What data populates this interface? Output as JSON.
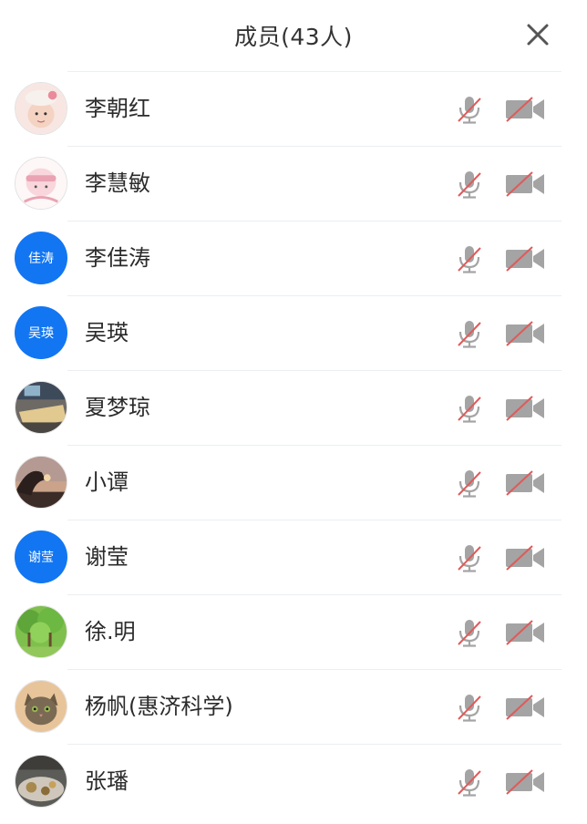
{
  "header": {
    "title": "成员(43人)"
  },
  "members": [
    {
      "name": "李朝红",
      "avatar_type": "photo",
      "avatar_scene": "baby"
    },
    {
      "name": "李慧敏",
      "avatar_type": "photo",
      "avatar_scene": "cartoon"
    },
    {
      "name": "李佳涛",
      "avatar_type": "text",
      "avatar_text": "佳涛"
    },
    {
      "name": "吴瑛",
      "avatar_type": "text",
      "avatar_text": "吴瑛"
    },
    {
      "name": "夏梦琼",
      "avatar_type": "photo",
      "avatar_scene": "room"
    },
    {
      "name": "小谭",
      "avatar_type": "photo",
      "avatar_scene": "sunset-hand"
    },
    {
      "name": "谢莹",
      "avatar_type": "text",
      "avatar_text": "谢莹"
    },
    {
      "name": "徐.明",
      "avatar_type": "photo",
      "avatar_scene": "trees"
    },
    {
      "name": "杨帆(惠济科学)",
      "avatar_type": "photo",
      "avatar_scene": "cat"
    },
    {
      "name": "张璠",
      "avatar_type": "photo",
      "avatar_scene": "table"
    }
  ],
  "icons": {
    "close": "close-icon",
    "mic": "mic-off-icon",
    "camera": "camera-off-icon"
  },
  "colors": {
    "avatar_blue": "#1276f2",
    "icon_gray": "#9a9a9a",
    "strike_red": "#e05a5a",
    "divider": "#eceef1"
  }
}
